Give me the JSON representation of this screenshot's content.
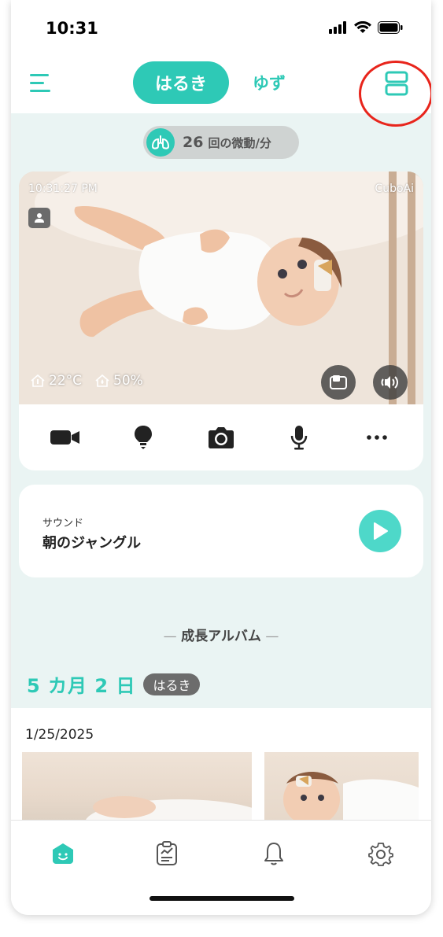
{
  "status_bar": {
    "time": "10:31"
  },
  "header": {
    "tabs": [
      {
        "label": "はるき",
        "active": true
      },
      {
        "label": "ゆず",
        "active": false
      }
    ],
    "accent_color": "#2ec9b6"
  },
  "breathing": {
    "value": "26",
    "unit": "回の微動/分"
  },
  "camera": {
    "timestamp": "10:31:27 PM",
    "brand": "CuboAi",
    "temperature": "22°C",
    "humidity": "50%"
  },
  "controls": [
    "video-icon",
    "light-bulb-icon",
    "camera-icon",
    "microphone-icon",
    "more-icon"
  ],
  "sound": {
    "label": "サウンド",
    "title": "朝のジャングル"
  },
  "album": {
    "heading": "成長アルバム",
    "age": "5 カ月 2 日",
    "child_name": "はるき",
    "date": "1/25/2025"
  },
  "tabbar": [
    "home-icon",
    "report-icon",
    "notification-bell-icon",
    "settings-gear-icon"
  ]
}
